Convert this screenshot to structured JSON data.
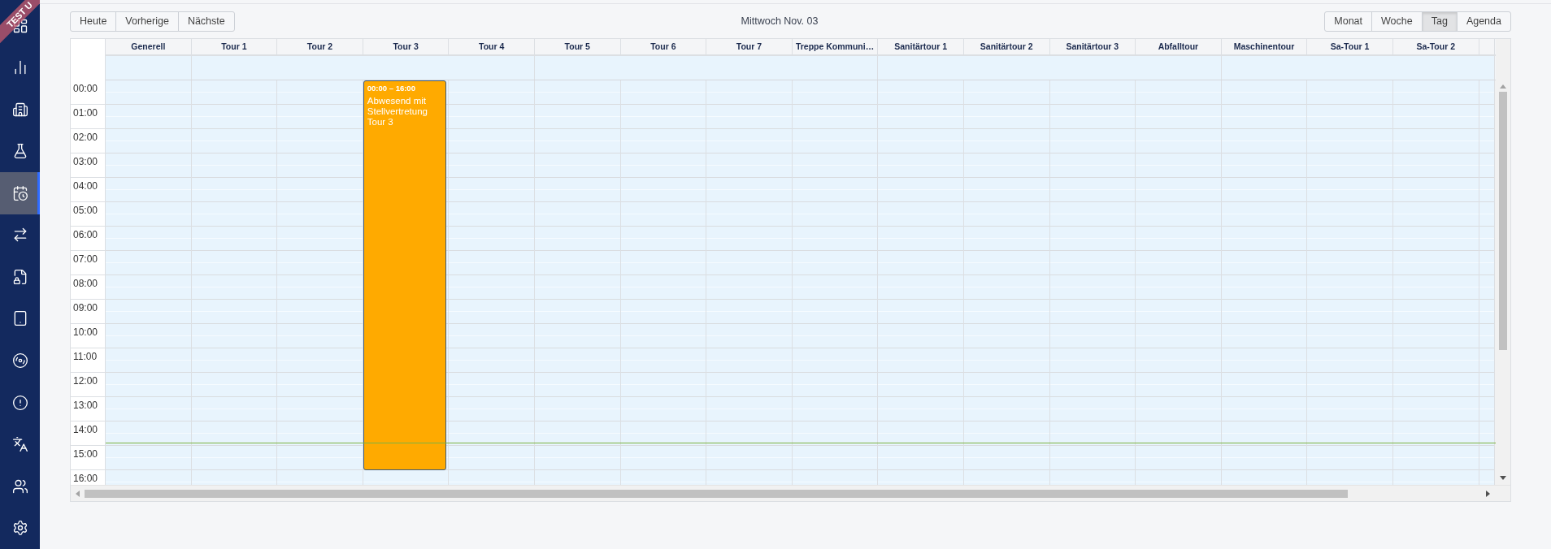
{
  "ribbon": {
    "text": "TEST U"
  },
  "sidebar": {
    "items": [
      {
        "selected": false
      },
      {
        "selected": false
      },
      {
        "selected": false
      },
      {
        "selected": false
      },
      {
        "selected": true
      },
      {
        "selected": false
      },
      {
        "selected": false
      },
      {
        "selected": false
      },
      {
        "selected": false
      },
      {
        "selected": false
      },
      {
        "selected": false
      },
      {
        "selected": false
      },
      {
        "selected": false
      }
    ]
  },
  "toolbar": {
    "navigation": [
      "Heute",
      "Vorherige",
      "Nächste"
    ],
    "title": "Mittwoch Nov. 03",
    "views": [
      {
        "label": "Monat",
        "selected": false
      },
      {
        "label": "Woche",
        "selected": false
      },
      {
        "label": "Tag",
        "selected": true
      },
      {
        "label": "Agenda",
        "selected": false
      }
    ]
  },
  "calendar": {
    "columns": [
      {
        "name": "Generell"
      },
      {
        "name": "Tour 1"
      },
      {
        "name": "Tour 2"
      },
      {
        "name": "Tour 3",
        "events": [
          {
            "time": "00:00 – 16:00",
            "title": "Abwesend mit Stellvertretung Tour 3"
          }
        ]
      },
      {
        "name": "Tour 4"
      },
      {
        "name": "Tour 5"
      },
      {
        "name": "Tour 6"
      },
      {
        "name": "Tour 7"
      },
      {
        "name": "Treppe Kommuni…"
      },
      {
        "name": "Sanitärtour 1"
      },
      {
        "name": "Sanitärtour 2"
      },
      {
        "name": "Sanitärtour 3"
      },
      {
        "name": "Abfalltour"
      },
      {
        "name": "Maschinentour"
      },
      {
        "name": "Sa-Tour 1"
      },
      {
        "name": "Sa-Tour 2"
      }
    ],
    "times": [
      "00:00",
      "01:00",
      "02:00",
      "03:00",
      "04:00",
      "05:00",
      "06:00",
      "07:00",
      "08:00",
      "09:00",
      "10:00",
      "11:00",
      "12:00",
      "13:00",
      "14:00",
      "15:00",
      "16:00"
    ]
  }
}
